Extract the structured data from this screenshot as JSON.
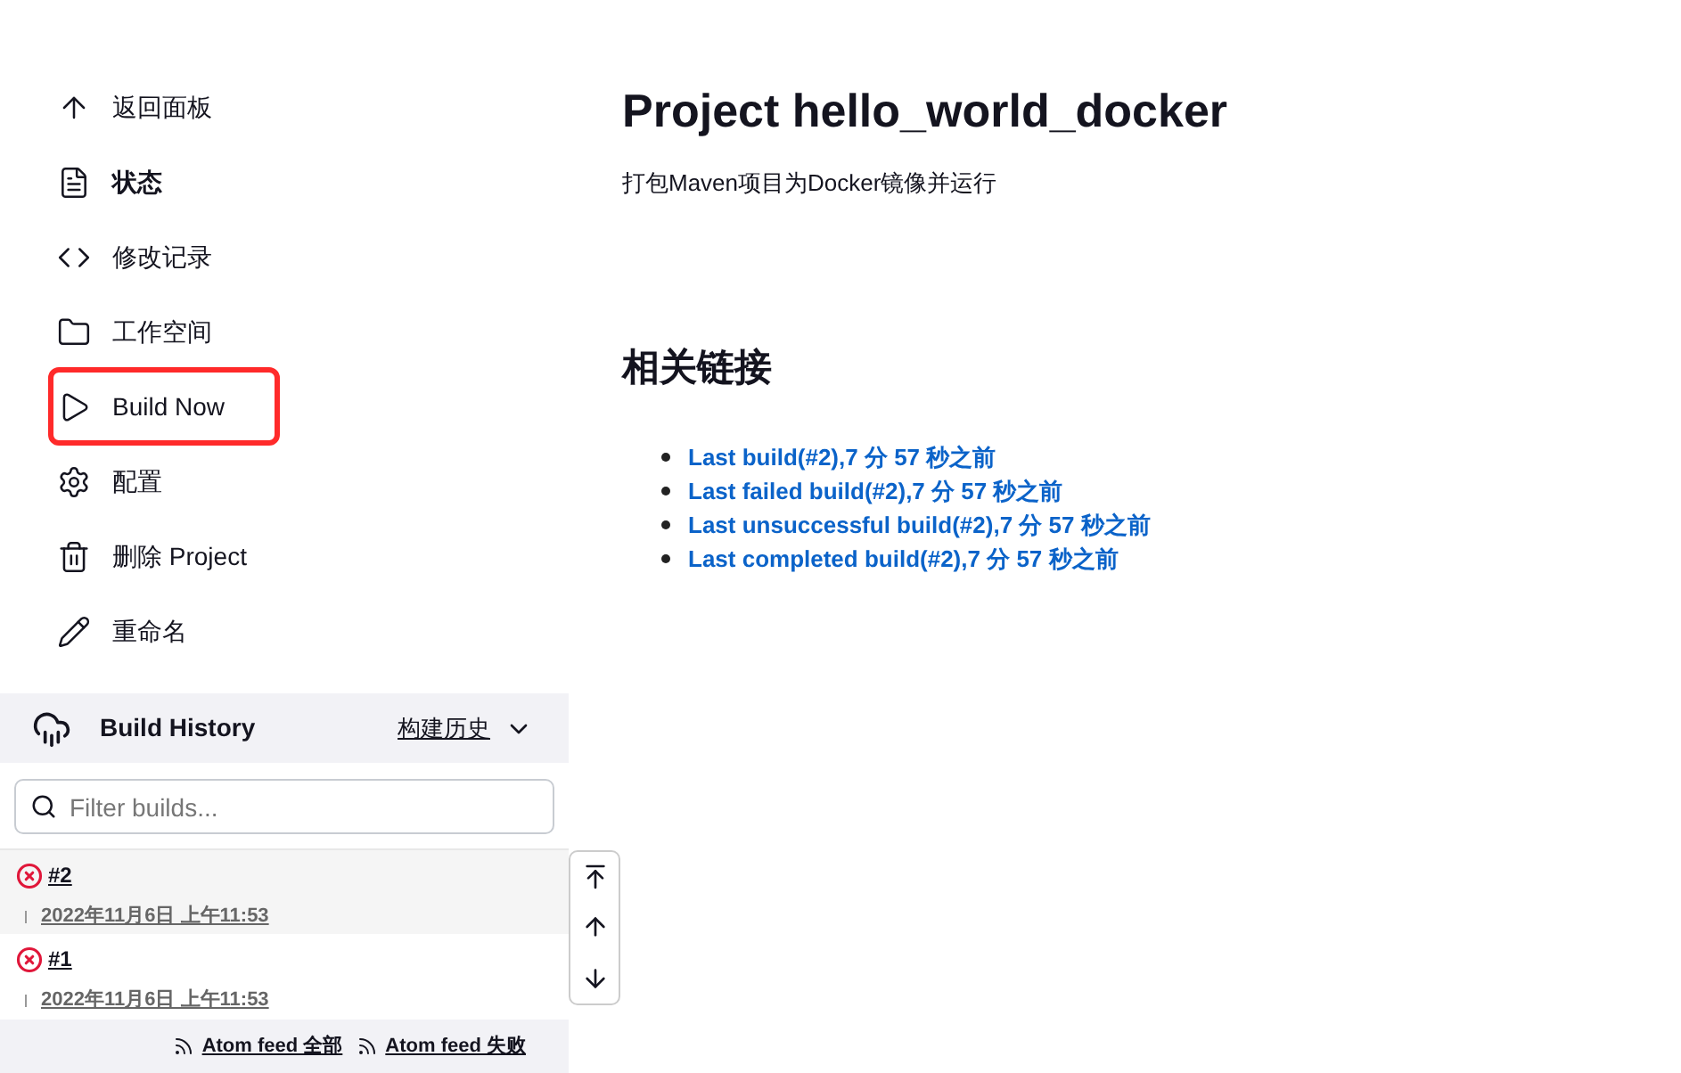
{
  "sidebar": {
    "items": [
      {
        "label": "返回面板",
        "selected": false,
        "highlighted": false
      },
      {
        "label": "状态",
        "selected": true,
        "highlighted": false
      },
      {
        "label": "修改记录",
        "selected": false,
        "highlighted": false
      },
      {
        "label": "工作空间",
        "selected": false,
        "highlighted": false
      },
      {
        "label": "Build Now",
        "selected": false,
        "highlighted": true
      },
      {
        "label": "配置",
        "selected": false,
        "highlighted": false
      },
      {
        "label": "删除 Project",
        "selected": false,
        "highlighted": false
      },
      {
        "label": "重命名",
        "selected": false,
        "highlighted": false
      }
    ]
  },
  "build_history": {
    "title": "Build History",
    "trend_link": "构建历史",
    "filter": {
      "placeholder": "Filter builds..."
    },
    "builds": [
      {
        "number": "#2",
        "date": "2022年11月6日 上午11:53",
        "kind": "failed",
        "selected": true
      },
      {
        "number": "#1",
        "date": "2022年11月6日 上午11:53",
        "kind": "failed",
        "selected": false
      }
    ],
    "feeds": [
      "Atom feed 全部",
      "Atom feed 失败"
    ]
  },
  "main": {
    "title": "Project hello_world_docker",
    "description": "打包Maven项目为Docker镜像并运行",
    "links_heading": "相关链接",
    "links": [
      "Last build(#2),7 分 57 秒之前",
      "Last failed build(#2),7 分 57 秒之前",
      "Last unsuccessful build(#2),7 分 57 秒之前",
      "Last completed build(#2),7 分 57 秒之前"
    ]
  }
}
